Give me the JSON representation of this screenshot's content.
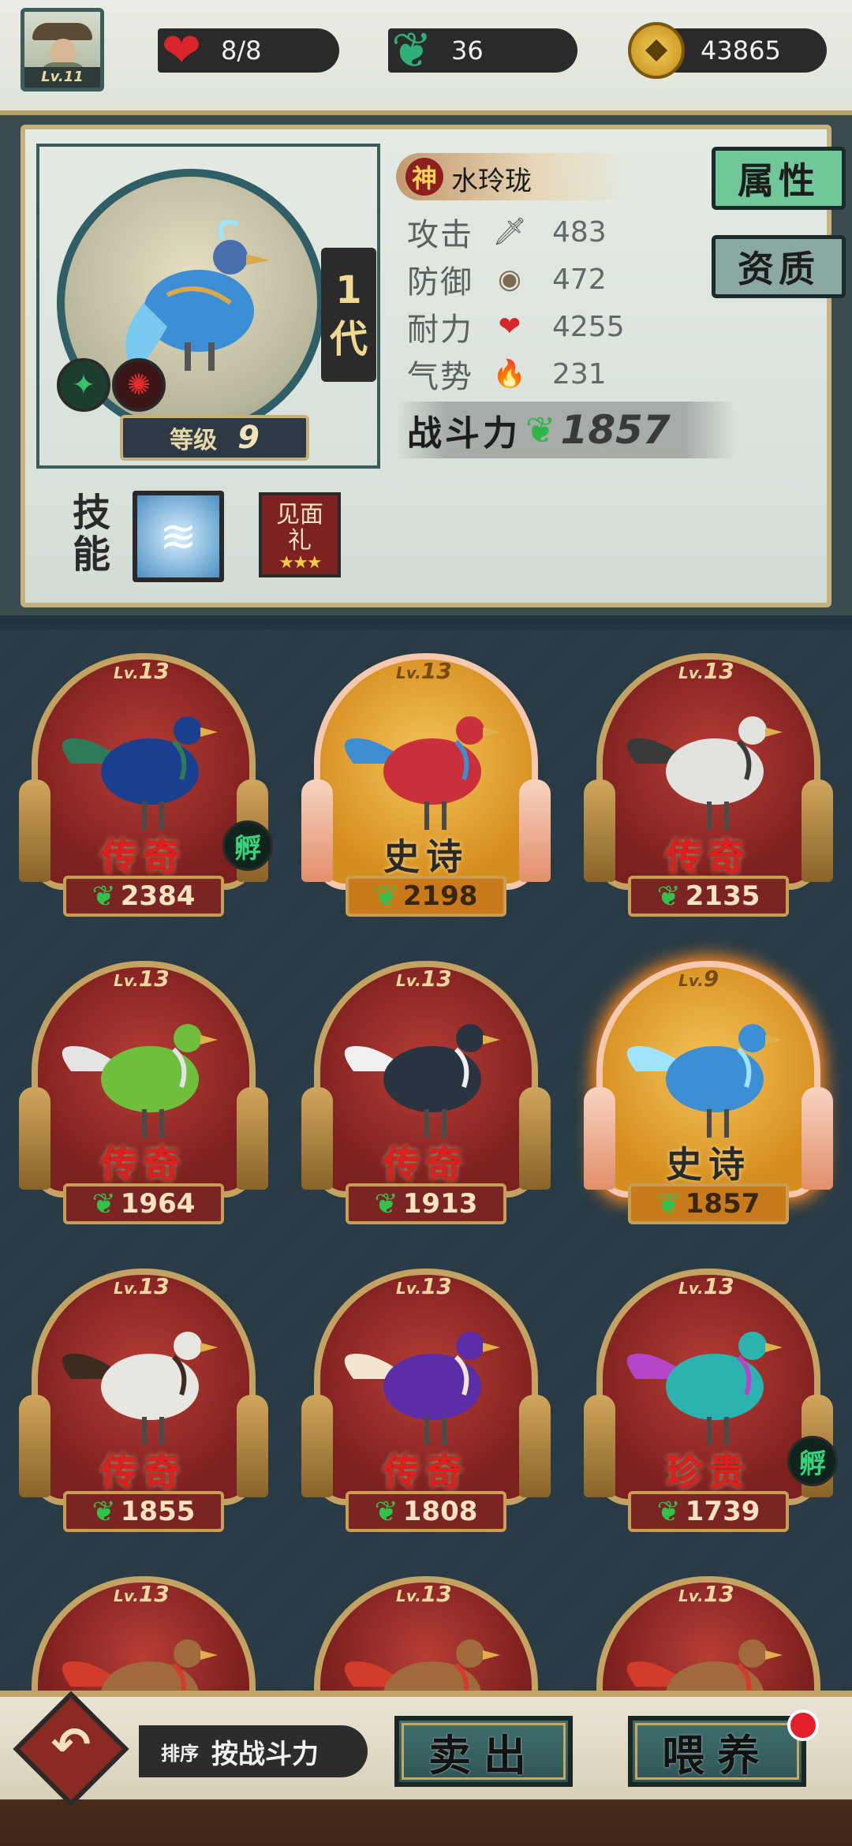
{
  "top": {
    "avatar_level": "Lv.11",
    "hearts": "8/8",
    "spirit": "36",
    "coins": "43865"
  },
  "pet": {
    "rank_badge": "神",
    "name": "水玲珑",
    "generation": [
      "1",
      "代"
    ],
    "level_label": "等级",
    "level": "9",
    "stats": [
      {
        "label": "攻击",
        "icon": "sword-icon",
        "glyph": "🗡",
        "value": "483"
      },
      {
        "label": "防御",
        "icon": "shield-icon",
        "glyph": "◉",
        "value": "472"
      },
      {
        "label": "耐力",
        "icon": "heart-icon",
        "glyph": "❤",
        "value": "4255"
      },
      {
        "label": "气势",
        "icon": "flame-icon",
        "glyph": "🔥",
        "value": "231"
      }
    ],
    "power_label": "战斗力",
    "power": "1857",
    "skill_label": [
      "技",
      "能"
    ],
    "gift_label": [
      "见面",
      "礼"
    ],
    "gift_stars": "★★★"
  },
  "tabs": [
    {
      "label": "属性",
      "active": true
    },
    {
      "label": "资质",
      "active": false
    }
  ],
  "birds": [
    {
      "level": "13",
      "rarity": "传奇",
      "power": "2384",
      "epic": false,
      "hatch": "孵",
      "color": "#1b3f8f",
      "accent": "#2f7a58"
    },
    {
      "level": "13",
      "rarity": "史诗",
      "power": "2198",
      "epic": true,
      "hatch": "",
      "color": "#c9303a",
      "accent": "#3d8ed0"
    },
    {
      "level": "13",
      "rarity": "传奇",
      "power": "2135",
      "epic": false,
      "hatch": "",
      "color": "#e2e2de",
      "accent": "#3a3a3a"
    },
    {
      "level": "13",
      "rarity": "传奇",
      "power": "1964",
      "epic": false,
      "hatch": "",
      "color": "#6fbf3d",
      "accent": "#e4e4e4"
    },
    {
      "level": "13",
      "rarity": "传奇",
      "power": "1913",
      "epic": false,
      "hatch": "",
      "color": "#2a3340",
      "accent": "#f0f0f0"
    },
    {
      "level": "9",
      "rarity": "史诗",
      "power": "1857",
      "epic": true,
      "hatch": "",
      "color": "#3c8fd4",
      "accent": "#9fe3ff",
      "selected": true
    },
    {
      "level": "13",
      "rarity": "传奇",
      "power": "1855",
      "epic": false,
      "hatch": "",
      "color": "#e8e6e0",
      "accent": "#3d2b22"
    },
    {
      "level": "13",
      "rarity": "传奇",
      "power": "1808",
      "epic": false,
      "hatch": "",
      "color": "#5b2ea8",
      "accent": "#f2e6d0"
    },
    {
      "level": "13",
      "rarity": "珍贵",
      "power": "1739",
      "epic": false,
      "hatch": "孵",
      "color": "#2bb3b0",
      "accent": "#b646c9"
    },
    {
      "level": "13",
      "rarity": "",
      "power": "",
      "epic": false,
      "hatch": "",
      "color": "#a06a3c",
      "accent": "#d23c2a",
      "partial": true
    },
    {
      "level": "13",
      "rarity": "",
      "power": "",
      "epic": false,
      "hatch": "",
      "color": "#a06a3c",
      "accent": "#d23c2a",
      "partial": true
    },
    {
      "level": "13",
      "rarity": "",
      "power": "",
      "epic": false,
      "hatch": "",
      "color": "#a06a3c",
      "accent": "#d23c2a",
      "partial": true
    }
  ],
  "bottom": {
    "sort_prefix": "排序",
    "sort_value": "按战斗力",
    "sell": "卖出",
    "feed": "喂养"
  }
}
